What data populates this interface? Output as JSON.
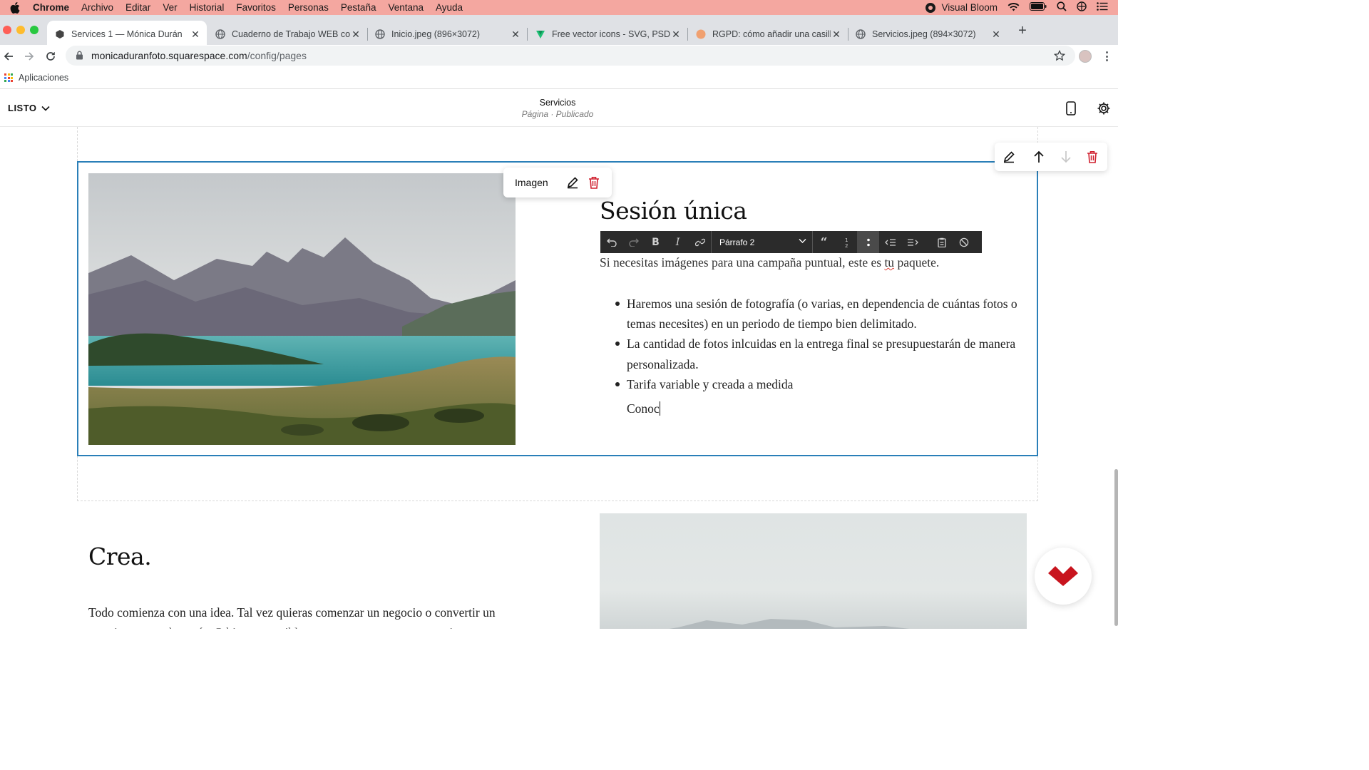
{
  "menubar": {
    "app": "Chrome",
    "items": [
      "Archivo",
      "Editar",
      "Ver",
      "Historial",
      "Favoritos",
      "Personas",
      "Pestaña",
      "Ventana",
      "Ayuda"
    ],
    "status_app": "Visual Bloom"
  },
  "tabs": [
    {
      "title": "Services 1 — Mónica Durán",
      "active": true
    },
    {
      "title": "Cuaderno de Trabajo WEB com",
      "active": false
    },
    {
      "title": "Inicio.jpeg (896×3072)",
      "active": false
    },
    {
      "title": "Free vector icons - SVG, PSD, I",
      "active": false
    },
    {
      "title": "RGPD: cómo añadir una casilla",
      "active": false
    },
    {
      "title": "Servicios.jpeg (894×3072)",
      "active": false
    }
  ],
  "address": {
    "host": "monicaduranfoto.squarespace.com",
    "path": "/config/pages"
  },
  "bookmarks": {
    "apps_label": "Aplicaciones"
  },
  "editor_header": {
    "done_label": "LISTO",
    "page_title": "Servicios",
    "page_status": "Página · Publicado"
  },
  "image_block": {
    "label": "Imagen"
  },
  "rte": {
    "style_label": "Párrafo 2"
  },
  "section": {
    "heading": "Sesión única",
    "intro_before": "Si necesitas imágenes para una campaña puntual, este es ",
    "intro_word": "tu",
    "intro_after": " paquete.",
    "bullets": [
      "Haremos una sesión de fotografía (o varias, en dependencia de cuántas fotos o temas necesites) en un periodo de tiempo bien delimitado.",
      "La cantidad de fotos inlcuidas en la entrega final se presupuestarán de manera personalizada.",
      "Tarifa variable y creada a medida"
    ],
    "typing": "Conoc"
  },
  "next_section": {
    "heading": "Crea.",
    "body_line1": "Todo comienza con una idea. Tal vez quieras comenzar un negocio o convertir un",
    "body_line2": "pasatiempo en algo más. O bien, es posible que tengas un proyecto creativo"
  },
  "colors": {
    "selection": "#2a7fb8",
    "delete": "#d0202f",
    "menubar": "#f4a7a0",
    "rte_bar": "#2b2b2b"
  }
}
